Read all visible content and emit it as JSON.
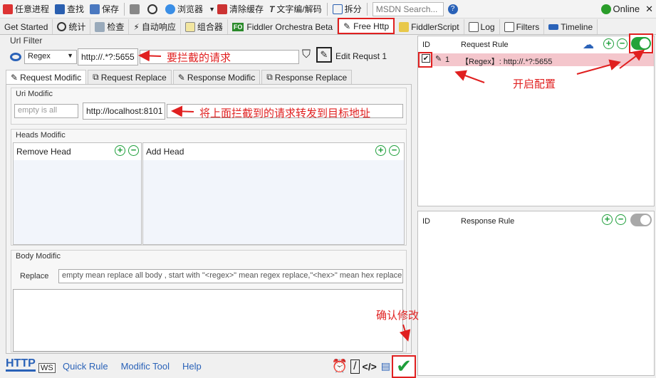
{
  "toolbar": {
    "items": [
      "任意进程",
      "查找",
      "保存",
      "浏览器",
      "清除缓存",
      "文字编/解码",
      "拆分"
    ],
    "search_placeholder": "MSDN Search...",
    "online": "Online",
    "close": "✕"
  },
  "tabs": [
    "Get Started",
    "统计",
    "检查",
    "自动响应",
    "组合器",
    "Fiddler Orchestra Beta",
    "Free Http",
    "FiddlerScript",
    "Log",
    "Filters",
    "Timeline"
  ],
  "fo_badge": "FO",
  "url_filter": {
    "title": "Url Filter",
    "mode": "Regex",
    "url": "http://.*?:5655",
    "edit_label": "Edit Requst 1"
  },
  "subtabs": [
    "Request Modific",
    "Request Replace",
    "Response Modific",
    "Response Replace"
  ],
  "uri_modific": {
    "title": "Uri Modific",
    "left_placeholder": "empty is all",
    "target": "http://localhost:8101"
  },
  "heads": {
    "title": "Heads Modific",
    "remove": "Remove Head",
    "add": "Add Head"
  },
  "body": {
    "title": "Body Modific",
    "replace_label": "Replace",
    "placeholder": "empty mean replace all body , start with \"<regex>\" mean regex replace,\"<hex>\" mean hex replace"
  },
  "bottom": {
    "logo": "HTTP",
    "logo_sub": "WS",
    "links": [
      "Quick Rule",
      "Modific Tool",
      "Help"
    ]
  },
  "request_rules": {
    "id": "ID",
    "header": "Request Rule",
    "rows": [
      {
        "id": "1",
        "text": "【Regex】: http://.*?:5655"
      }
    ]
  },
  "response_rules": {
    "id": "ID",
    "header": "Response Rule"
  },
  "annotations": {
    "intercept": "要拦截的请求",
    "forward": "将上面拦截到的请求转发到目标地址",
    "enable": "开启配置",
    "confirm": "确认修改"
  },
  "colors": {
    "accent": "#e02020",
    "green": "#1e9e3a",
    "rowpink": "#f4c6cc"
  }
}
